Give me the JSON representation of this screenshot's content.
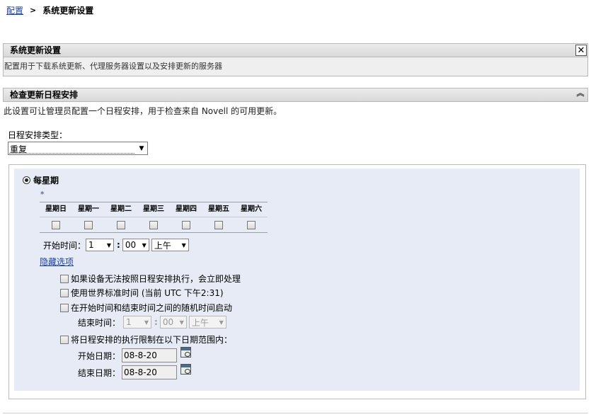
{
  "breadcrumb": {
    "parent": "配置",
    "current": "系统更新设置"
  },
  "header_panel": {
    "title": "系统更新设置",
    "description": "配置用于下载系统更新、代理服务器设置以及安排更新的服务器",
    "close_icon": "close-icon"
  },
  "schedule_panel": {
    "title": "检查更新日程安排",
    "collapse_icon": "double-chevron-up-icon",
    "intro": "此设置可让管理员配置一个日程安排，用于检查来自 Novell 的可用更新。",
    "type_label": "日程安排类型：",
    "type_value": "重复"
  },
  "weekly": {
    "radio_label": "每星期",
    "required_mark": "*",
    "days": [
      "星期日",
      "星期一",
      "星期二",
      "星期三",
      "星期四",
      "星期五",
      "星期六"
    ],
    "start_time_label": "开始时间：",
    "start_hour": "1",
    "start_minute": "00",
    "start_ampm": "上午",
    "hide_options_link": "隐藏选项"
  },
  "options": {
    "run_immediately": "如果设备无法按照日程安排执行，会立即处理",
    "use_utc": "使用世界标准时间 (当前 UTC 下午2:31)",
    "random_start": "在开始时间和结束时间之间的随机时间启动",
    "end_time_label": "结束时间：",
    "end_hour": "1",
    "end_minute": "00",
    "end_ampm": "上午",
    "limit_dates": "将日程安排的执行限制在以下日期范围内：",
    "start_date_label": "开始日期：",
    "start_date_value": "08-8-20",
    "end_date_label": "结束日期：",
    "end_date_value": "08-8-20"
  }
}
